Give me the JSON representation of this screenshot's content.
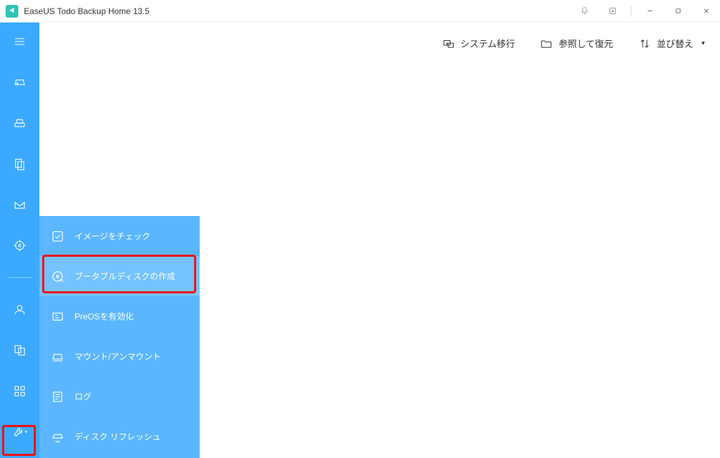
{
  "titlebar": {
    "title": "EaseUS Todo Backup Home 13.5"
  },
  "sidebar": {
    "items": [
      {
        "name": "menu-icon"
      },
      {
        "name": "disk-backup-icon"
      },
      {
        "name": "system-backup-icon"
      },
      {
        "name": "file-backup-icon"
      },
      {
        "name": "mail-backup-icon"
      },
      {
        "name": "target-icon"
      },
      {
        "name": "divider"
      },
      {
        "name": "account-icon"
      },
      {
        "name": "clone-icon"
      },
      {
        "name": "apps-icon"
      },
      {
        "name": "tools-icon"
      }
    ]
  },
  "submenu": {
    "items": [
      {
        "icon": "check-image-icon",
        "label": "イメージをチェック",
        "active": false
      },
      {
        "icon": "create-bootable-icon",
        "label": "ブータブルディスクの作成",
        "active": true
      },
      {
        "icon": "enable-preos-icon",
        "label": "PreOSを有効化",
        "active": false
      },
      {
        "icon": "mount-icon",
        "label": "マウント/アンマウント",
        "active": false
      },
      {
        "icon": "log-icon",
        "label": "ログ",
        "active": false
      },
      {
        "icon": "disk-refresh-icon",
        "label": "ディスク リフレッシュ",
        "active": false
      }
    ]
  },
  "toolbar": {
    "system_transfer": "システム移行",
    "browse_restore": "参照して復元",
    "sort": "並び替え"
  }
}
